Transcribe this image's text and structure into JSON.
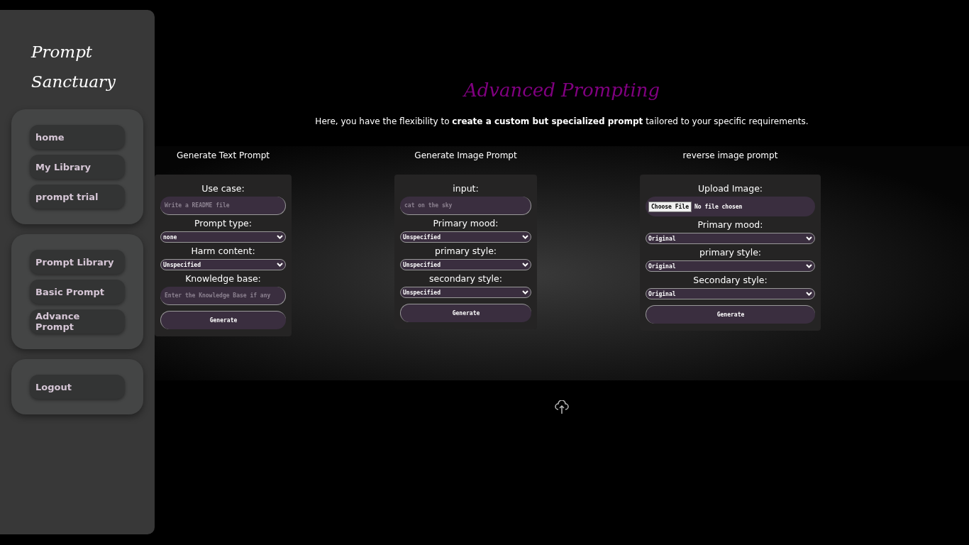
{
  "sidebar": {
    "brand_lines": [
      "Prompt",
      "Sanctuary"
    ],
    "groups": [
      [
        "home",
        "My Library",
        "prompt trial"
      ],
      [
        "Prompt Library",
        "Basic Prompt",
        "Advance Prompt"
      ],
      [
        "Logout"
      ]
    ]
  },
  "main": {
    "title": "Advanced Prompting",
    "intro": "Here, you have the flexibility to **create a custom but specialized prompt** tailored to your specific requirements."
  },
  "panels": [
    {
      "title": "Generate Text Prompt",
      "fields": [
        {
          "kind": "text",
          "label": "Use case:",
          "placeholder": "Write a README file"
        },
        {
          "kind": "select",
          "label": "Prompt type:",
          "value": "none"
        },
        {
          "kind": "select",
          "label": "Harm content:",
          "value": "Unspecified"
        },
        {
          "kind": "text",
          "label": "Knowledge base:",
          "placeholder": "Enter the Knowledge Base if any"
        }
      ],
      "button": "Generate"
    },
    {
      "title": "Generate Image Prompt",
      "fields": [
        {
          "kind": "text",
          "label": "input:",
          "placeholder": "cat on the sky"
        },
        {
          "kind": "select",
          "label": "Primary mood:",
          "value": "Unspecified"
        },
        {
          "kind": "select",
          "label": "primary style:",
          "value": "Unspecified"
        },
        {
          "kind": "select",
          "label": "secondary style:",
          "value": "Unspecified"
        }
      ],
      "button": "Generate"
    },
    {
      "title": "reverse image prompt",
      "fields": [
        {
          "kind": "file",
          "label": "Upload Image:",
          "button": "Choose File",
          "status": "No file chosen"
        },
        {
          "kind": "select",
          "label": "Primary mood:",
          "value": "Original"
        },
        {
          "kind": "select",
          "label": "primary style:",
          "value": "Original"
        },
        {
          "kind": "select",
          "label": "Secondary style:",
          "value": "Original"
        }
      ],
      "button": "Generate"
    }
  ]
}
